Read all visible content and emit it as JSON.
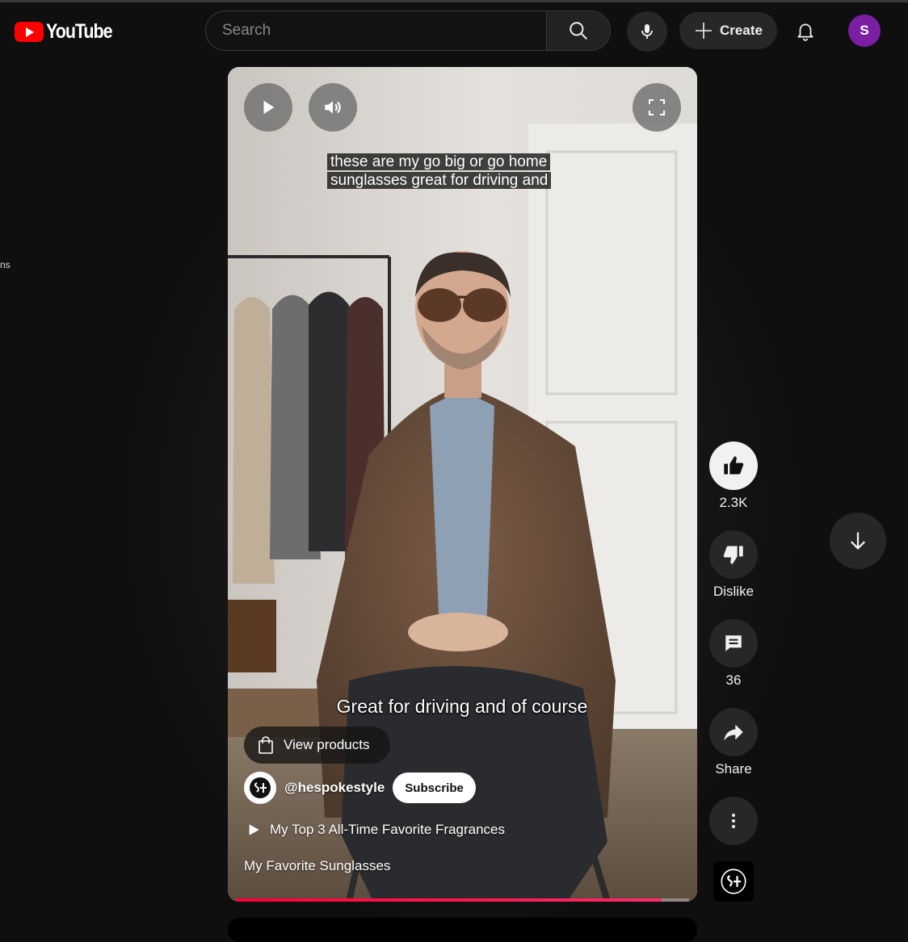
{
  "header": {
    "logo_text": "YouTube",
    "search_placeholder": "Search",
    "create_label": "Create",
    "avatar_letter": "S"
  },
  "sidebar_edge_text": "ns",
  "player": {
    "caption_line": "these are my go big or go home sunglasses great for driving and",
    "burned_in_caption": "Great for driving and of course",
    "products_label": "View products",
    "channel_handle": "@hespokestyle",
    "subscribe_label": "Subscribe",
    "playlist_label": "My Top 3 All-Time Favorite Fragrances",
    "video_title": "My Favorite Sunglasses",
    "progress_fraction": 0.94
  },
  "actions": {
    "like_count": "2.3K",
    "dislike_label": "Dislike",
    "comment_count": "36",
    "share_label": "Share"
  },
  "colors": {
    "brand_red": "#ff0000",
    "background": "#0f0f0f",
    "avatar_purple": "#7b1fa2",
    "progress_red": "#ff0033"
  }
}
